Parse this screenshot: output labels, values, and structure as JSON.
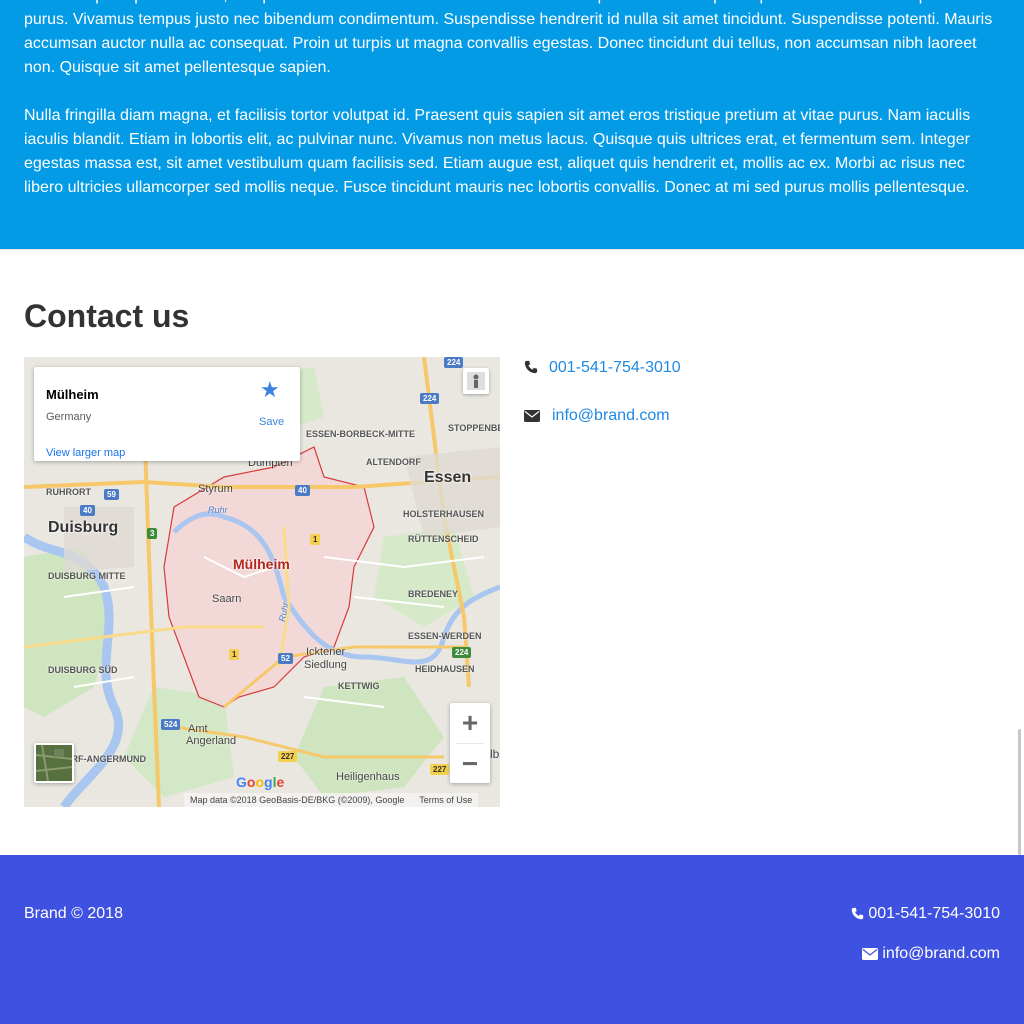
{
  "about": {
    "paragraph1": "Pellentesque a porttitor sem, sed porttitor tellus. Morbi finibus ac odio non consequat. Sed et semper turpis. Curabitur vitae aliquam purus. Vivamus tempus justo nec bibendum condimentum. Suspendisse hendrerit id nulla sit amet tincidunt. Suspendisse potenti. Mauris accumsan auctor nulla ac consequat. Proin ut turpis ut magna convallis egestas. Donec tincidunt dui tellus, non accumsan nibh laoreet non. Quisque sit amet pellentesque sapien.",
    "paragraph2": "Nulla fringilla diam magna, et facilisis tortor volutpat id. Praesent quis sapien sit amet eros tristique pretium at vitae purus. Nam iaculis iaculis blandit. Etiam in lobortis elit, ac pulvinar nunc. Vivamus non metus lacus. Quisque quis ultrices erat, et fermentum sem. Integer egestas massa est, sit amet vestibulum quam facilisis sed. Etiam augue est, aliquet quis hendrerit et, mollis ac ex. Morbi ac risus nec libero ultricies ullamcorper sed mollis neque. Fusce tincidunt mauris nec lobortis convallis. Donec at mi sed purus mollis pellentesque."
  },
  "contact": {
    "title": "Contact us",
    "phone": "001-541-754-3010",
    "email": "info@brand.com"
  },
  "map": {
    "place_name": "Mülheim",
    "place_country": "Germany",
    "view_larger": "View larger map",
    "save_label": "Save",
    "zoom_in": "+",
    "zoom_out": "−",
    "logo": "Google",
    "attribution": "Map data ©2018 GeoBasis-DE/BKG (©2009), Google",
    "terms": "Terms of Use",
    "labels": {
      "essen": "Essen",
      "duisburg": "Duisburg",
      "muelheim": "Mülheim",
      "styrum": "Styrum",
      "duempten": "Dümpten",
      "saarn": "Saarn",
      "icktener": "Icktener",
      "siedlung": "Siedlung",
      "kettwig": "Kettwig",
      "amt": "Amt",
      "angerland": "Angerland",
      "heiligenhaus": "Heiligenhaus",
      "essen_borbeck": "ESSEN-BORBECK-MITTE",
      "altendorf": "ALTENDORF",
      "stoppenberg": "STOPPENBERG",
      "holsterhausen": "HOLSTERHAUSEN",
      "ruettenscheid": "RÜTTENSCHEID",
      "bredeney": "BREDENEY",
      "essen_werden": "ESSEN-WERDEN",
      "heidhausen": "HEIDHAUSEN",
      "kettwig_caps": "KETTWIG",
      "ruhrort": "RUHRORT",
      "duisburg_mitte": "DUISBURG MITTE",
      "duisburg_sued": "DUISBURG SÜD",
      "angermund": "DORF-ANGERMUND",
      "ruhr1": "Ruhr",
      "ruhr2": "Ruhr",
      "lb": "lb"
    },
    "shields": [
      "224",
      "59",
      "40",
      "3",
      "40",
      "1",
      "52",
      "1",
      "224",
      "224",
      "524",
      "227",
      "227"
    ]
  },
  "footer": {
    "brand": "Brand © 2018",
    "phone": "001-541-754-3010",
    "email": "info@brand.com"
  },
  "icons": {
    "phone": "phone-icon",
    "email": "envelope-icon",
    "star": "star-icon"
  }
}
